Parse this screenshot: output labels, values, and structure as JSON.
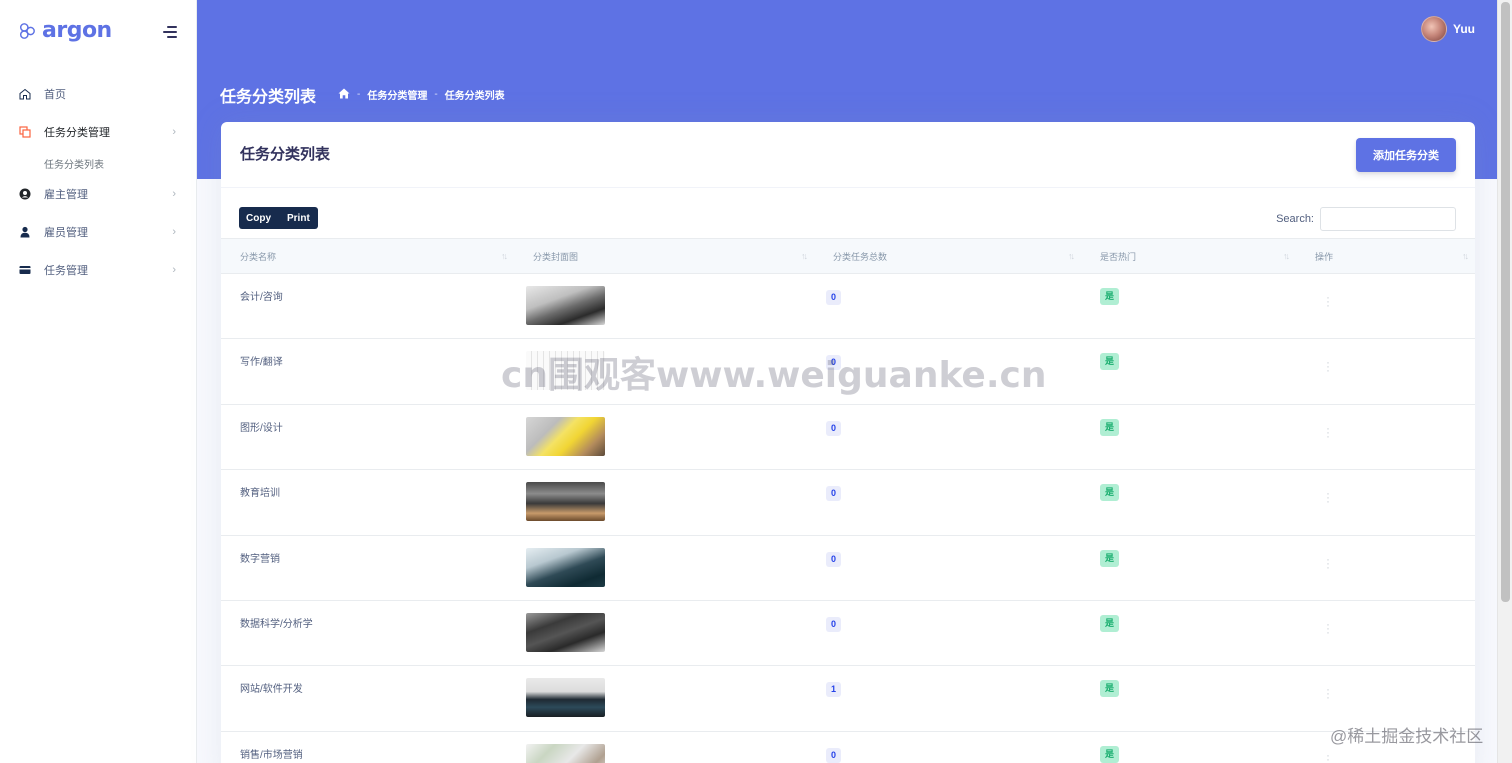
{
  "brand": {
    "name": "argon"
  },
  "sidebar": {
    "items": [
      {
        "label": "首页",
        "icon": "home-icon",
        "has_chevron": false
      },
      {
        "label": "任务分类管理",
        "icon": "copy-icon",
        "has_chevron": true,
        "active": true,
        "sub": [
          {
            "label": "任务分类列表"
          }
        ]
      },
      {
        "label": "雇主管理",
        "icon": "user-circle-icon",
        "has_chevron": true
      },
      {
        "label": "雇员管理",
        "icon": "user-icon",
        "has_chevron": true
      },
      {
        "label": "任务管理",
        "icon": "card-icon",
        "has_chevron": true
      }
    ]
  },
  "header": {
    "user_name": "Yuu",
    "page_title": "任务分类列表",
    "breadcrumb": [
      "任务分类管理",
      "任务分类列表"
    ]
  },
  "card": {
    "title": "任务分类列表",
    "add_button": "添加任务分类",
    "toolbar": {
      "copy": "Copy",
      "print": "Print"
    },
    "search_label": "Search:"
  },
  "table": {
    "columns": [
      "分类名称",
      "分类封面图",
      "分类任务总数",
      "是否热门",
      "操作"
    ],
    "rows": [
      {
        "name": "会计/咨询",
        "count": "0",
        "hot": "是",
        "thumb": "handshake-photo"
      },
      {
        "name": "写作/翻译",
        "count": "0",
        "hot": "是",
        "thumb": "keyboard-photo"
      },
      {
        "name": "图形/设计",
        "count": "0",
        "hot": "是",
        "thumb": "design-photo"
      },
      {
        "name": "教育培训",
        "count": "0",
        "hot": "是",
        "thumb": "classroom-photo"
      },
      {
        "name": "数字营销",
        "count": "0",
        "hot": "是",
        "thumb": "laptop-typing-photo"
      },
      {
        "name": "数据科学/分析学",
        "count": "0",
        "hot": "是",
        "thumb": "tablet-data-photo"
      },
      {
        "name": "网站/软件开发",
        "count": "1",
        "hot": "是",
        "thumb": "code-screen-photo"
      },
      {
        "name": "销售/市场营销",
        "count": "0",
        "hot": "是",
        "thumb": "desk-items-photo"
      }
    ]
  },
  "watermarks": {
    "center": "cn围观客www.weiguanke.cn",
    "corner": "@稀土掘金技术社区"
  },
  "colors": {
    "primary": "#5e72e4",
    "dark_button": "#172b4d",
    "hot_badge_bg": "#b0eed3",
    "hot_badge_text": "#1aae6f"
  }
}
